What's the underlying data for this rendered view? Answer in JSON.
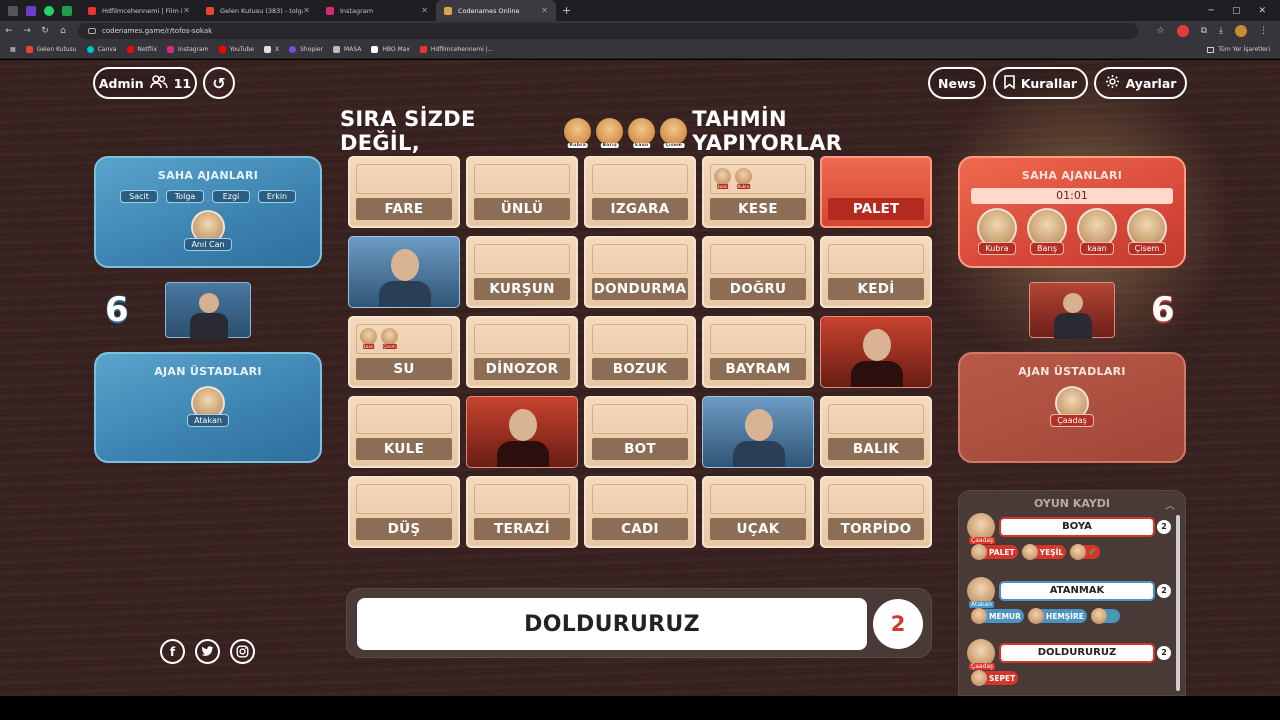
{
  "browser": {
    "tabs": [
      {
        "title": "Hdfilmcehennemi | Film izle | H",
        "active": false
      },
      {
        "title": "Gelen Kutusu (383) - tolgatezel",
        "active": false
      },
      {
        "title": "Instagram",
        "active": false
      },
      {
        "title": "Codenames Online",
        "active": true
      }
    ],
    "url": "codenames.game/r/tofos-sokak",
    "bookmarks": [
      "Gelen Kutusu",
      "Canva",
      "Netflix",
      "Instagram",
      "YouTube",
      "X",
      "Shopier",
      "MASA",
      "HBO Max",
      "Hdfilmcehennemi |..."
    ],
    "bookmarks_right": "Tüm Yer İşaretleri"
  },
  "top": {
    "admin_label": "Admin",
    "player_count": "11",
    "news_label": "News",
    "rules_label": "Kurallar",
    "settings_label": "Ayarlar"
  },
  "headline": {
    "prefix": "SIRA SİZDE DEĞİL,",
    "suffix": "TAHMİN YAPIYORLAR",
    "players": [
      "Kubra",
      "Barış",
      "kaan",
      "Çisem"
    ]
  },
  "blue_team": {
    "operatives_title": "SAHA AJANLARI",
    "operatives": [
      "Sacit",
      "Tolga",
      "Ezgi",
      "Erkin"
    ],
    "operative_main": "Anıl Can",
    "score": "6",
    "spymasters_title": "AJAN ÜSTADLARI",
    "spymaster": "Atakan"
  },
  "red_team": {
    "operatives_title": "SAHA AJANLARI",
    "timer": "01:01",
    "operatives": [
      "Kubra",
      "Barış",
      "kaan",
      "Çisem"
    ],
    "score": "6",
    "spymasters_title": "AJAN ÜSTADLARI",
    "spymaster": "Çaadaş"
  },
  "board": [
    {
      "word": "FARE",
      "type": "word"
    },
    {
      "word": "ÜNLÜ",
      "type": "word"
    },
    {
      "word": "IZGARA",
      "type": "word"
    },
    {
      "word": "KESE",
      "type": "word",
      "marks": [
        "kaan",
        "Kubra"
      ]
    },
    {
      "word": "PALET",
      "type": "red-word"
    },
    {
      "word": "",
      "type": "blue-agent"
    },
    {
      "word": "KURŞUN",
      "type": "word"
    },
    {
      "word": "DONDURMA",
      "type": "word"
    },
    {
      "word": "DOĞRU",
      "type": "word"
    },
    {
      "word": "KEDİ",
      "type": "word"
    },
    {
      "word": "SU",
      "type": "word",
      "marks": [
        "kaan",
        "Çisem"
      ]
    },
    {
      "word": "DİNOZOR",
      "type": "word"
    },
    {
      "word": "BOZUK",
      "type": "word"
    },
    {
      "word": "BAYRAM",
      "type": "word"
    },
    {
      "word": "",
      "type": "red-agent"
    },
    {
      "word": "KULE",
      "type": "word"
    },
    {
      "word": "",
      "type": "red-agent"
    },
    {
      "word": "BOT",
      "type": "word"
    },
    {
      "word": "",
      "type": "blue-agent"
    },
    {
      "word": "BALIK",
      "type": "word"
    },
    {
      "word": "DÜŞ",
      "type": "word"
    },
    {
      "word": "TERAZİ",
      "type": "word"
    },
    {
      "word": "CADI",
      "type": "word"
    },
    {
      "word": "UÇAK",
      "type": "word"
    },
    {
      "word": "TORPİDO",
      "type": "word"
    }
  ],
  "clue": {
    "word": "DOLDURURUZ",
    "number": "2"
  },
  "log": {
    "title": "OYUN KAYDI",
    "entries": [
      {
        "giver": "Çaadaş",
        "team": "red",
        "clue": "BOYA",
        "number": "2",
        "guesses": [
          {
            "word": "PALET",
            "color": "red"
          },
          {
            "word": "YEŞİL",
            "color": "red"
          },
          {
            "word": "",
            "color": "red",
            "check": true
          }
        ]
      },
      {
        "giver": "Atakan",
        "team": "blue",
        "clue": "ATANMAK",
        "number": "2",
        "guesses": [
          {
            "word": "MEMUR",
            "color": "blue"
          },
          {
            "word": "HEMŞİRE",
            "color": "blue"
          },
          {
            "word": "",
            "color": "blue",
            "check": true
          }
        ]
      },
      {
        "giver": "Çaadaş",
        "team": "red",
        "clue": "DOLDURURUZ",
        "number": "2",
        "guesses": [
          {
            "word": "SEPET",
            "color": "red"
          }
        ]
      }
    ]
  },
  "colors": {
    "blue": "#3c82b0",
    "red": "#d8493a",
    "card": "#f4d9bd",
    "label": "#8c6d55"
  }
}
